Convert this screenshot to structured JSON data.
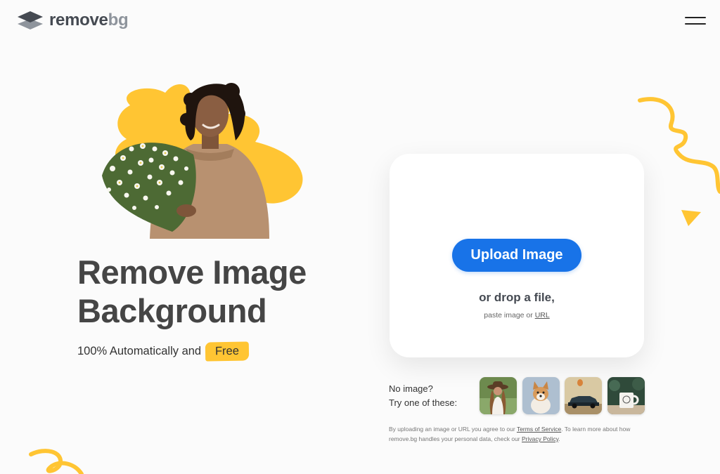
{
  "header": {
    "logo_text_primary": "remove",
    "logo_text_secondary": "bg",
    "menu_icon": "hamburger-menu-icon"
  },
  "hero": {
    "title_line1": "Remove Image",
    "title_line2": "Background",
    "subtitle": "100% Automatically and",
    "free_badge": "Free"
  },
  "upload": {
    "button_label": "Upload Image",
    "drop_text": "or drop a file,",
    "paste_prefix": "paste image or",
    "url_link": "URL"
  },
  "samples": {
    "label_line1": "No image?",
    "label_line2": "Try one of these:",
    "items": [
      "woman-hat-sample",
      "dog-sample",
      "car-sample",
      "mug-sample"
    ]
  },
  "legal": {
    "part1": "By uploading an image or URL you agree to our",
    "tos_link": "Terms of Service",
    "part2": ". To learn more about how remove.bg handles your personal data, check our",
    "privacy_link": "Privacy Policy",
    "part3": "."
  },
  "colors": {
    "accent_blue": "#1873e8",
    "accent_yellow": "#ffc533",
    "text_dark": "#454545"
  }
}
